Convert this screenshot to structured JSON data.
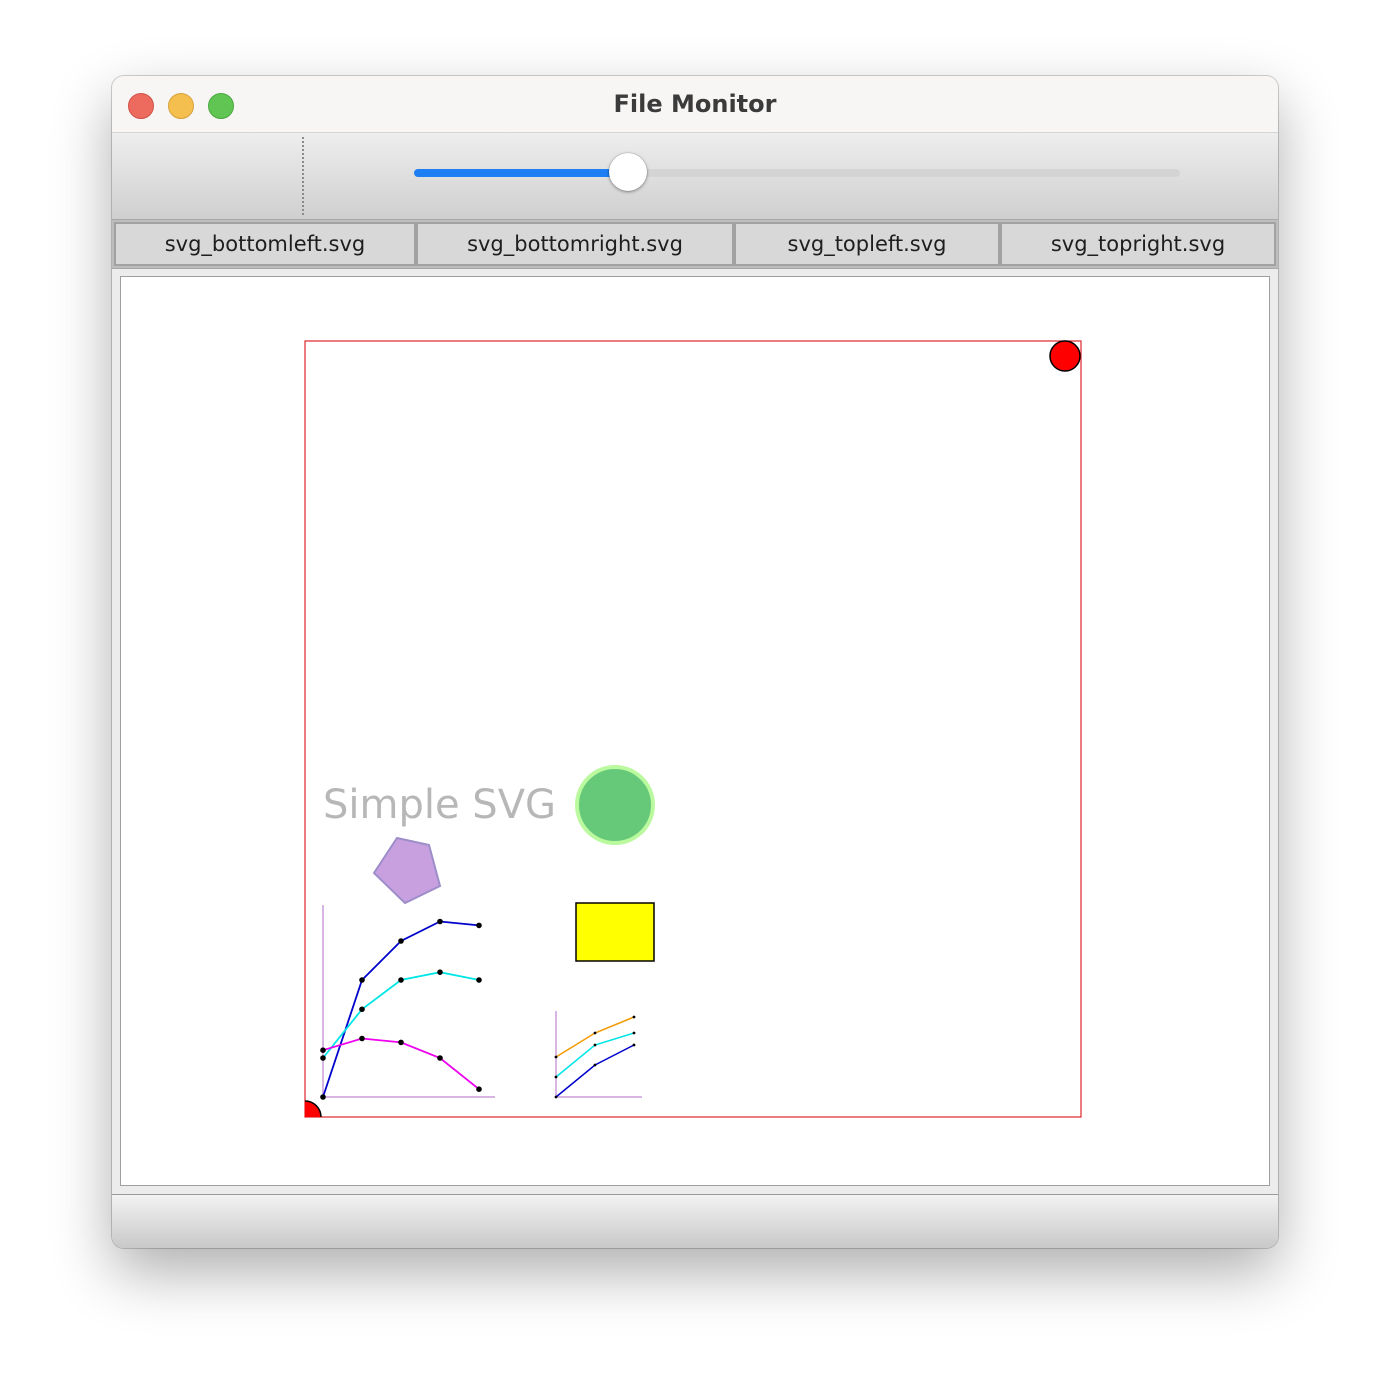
{
  "window": {
    "title": "File Monitor"
  },
  "toolbar": {
    "slider_value": 0.28
  },
  "tabs": [
    {
      "label": "svg_bottomleft.svg"
    },
    {
      "label": "svg_bottomright.svg"
    },
    {
      "label": "svg_topleft.svg"
    },
    {
      "label": "svg_topright.svg"
    }
  ],
  "svg_view": {
    "text": "Simple SVG",
    "colors": {
      "frame": "#e0262b",
      "corner_marker": "#ff0000",
      "circle_fill": "#66c979",
      "circle_stroke": "#bbf99f",
      "pentagon_fill": "#c8a0df",
      "pentagon_stroke": "#9d8ec9",
      "rect_fill": "#ffff00",
      "axis": "#b06bc7",
      "text": "#b7b7b7"
    },
    "charts": [
      {
        "series": [
          {
            "color": "#0000cc",
            "values": [
              0,
              60,
              80,
              90,
              88
            ]
          },
          {
            "color": "#00e6e6",
            "values": [
              20,
              45,
              60,
              64,
              60
            ]
          },
          {
            "color": "#ee00ee",
            "values": [
              24,
              30,
              28,
              20,
              4
            ]
          }
        ]
      },
      {
        "series": [
          {
            "color": "#f39a00",
            "values": [
              20,
              32,
              40
            ]
          },
          {
            "color": "#00e6e6",
            "values": [
              10,
              26,
              32
            ]
          },
          {
            "color": "#0000cc",
            "values": [
              0,
              16,
              26
            ]
          }
        ]
      }
    ]
  }
}
